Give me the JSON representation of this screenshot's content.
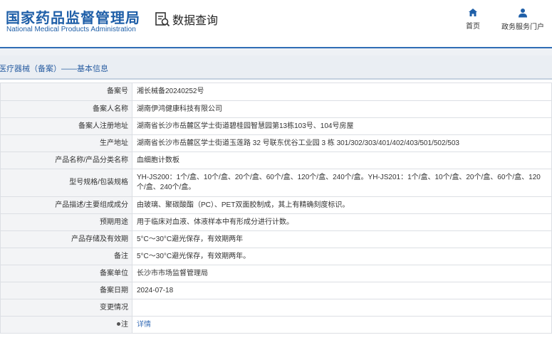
{
  "header": {
    "logo_cn": "国家药品监督管理局",
    "logo_en": "National Medical Products Administration",
    "query_title": "数据查询",
    "nav_home": "首页",
    "nav_user": "政务服务门户"
  },
  "breadcrumb": "医疗器械（备案）——基本信息",
  "rows": [
    {
      "label": "备案号",
      "value": "湘长械备20240252号"
    },
    {
      "label": "备案人名称",
      "value": "湖南伊鸿健康科技有限公司"
    },
    {
      "label": "备案人注册地址",
      "value": "湖南省长沙市岳麓区学士街道碧桂园智慧园第13栋103号、104号房屋"
    },
    {
      "label": "生产地址",
      "value": "湖南省长沙市岳麓区学士街道玉莲路 32 号联东优谷工业园 3 栋 301/302/303/401/402/403/501/502/503"
    },
    {
      "label": "产品名称/产品分类名称",
      "value": "血细胞计数板"
    },
    {
      "label": "型号规格/包装规格",
      "value": "YH-JS200：1个/盒、10个/盒、20个/盒、60个/盒、120个/盒、240个/盒。YH-JS201：1个/盒、10个/盒、20个/盒、60个/盒、120个/盒、240个/盒。"
    },
    {
      "label": "产品描述/主要组成成分",
      "value": "由玻璃、聚碳酸酯（PC）、PET双面胶制成，其上有精确刻度标识。"
    },
    {
      "label": "预期用途",
      "value": "用于临床对血液、体液样本中有形成分进行计数。"
    },
    {
      "label": "产品存储及有效期",
      "value": "5°C～30°C避光保存，有效期两年"
    },
    {
      "label": "备注",
      "value": "5°C～30°C避光保存，有效期两年。"
    },
    {
      "label": "备案单位",
      "value": "长沙市市场监督管理局"
    },
    {
      "label": "备案日期",
      "value": "2024-07-18"
    },
    {
      "label": "变更情况",
      "value": ""
    },
    {
      "label": "注",
      "value": "详情"
    }
  ]
}
